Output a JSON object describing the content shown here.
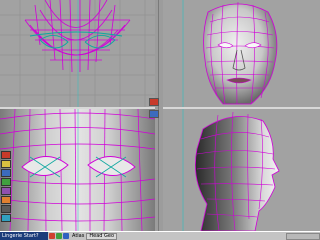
{
  "taskbar": {
    "start_label": "Lingerie Start?",
    "item_label": "Atlas",
    "window_button": "Head Geo"
  },
  "colors": {
    "wire_magenta": "#d000d8",
    "wire_teal": "#10a8a0",
    "viewport_bg": "#a2a2a2",
    "taskbar": "#c4c4c4",
    "start_button": "#1c3c7a"
  },
  "viewports": [
    "top",
    "perspective",
    "front",
    "side"
  ]
}
